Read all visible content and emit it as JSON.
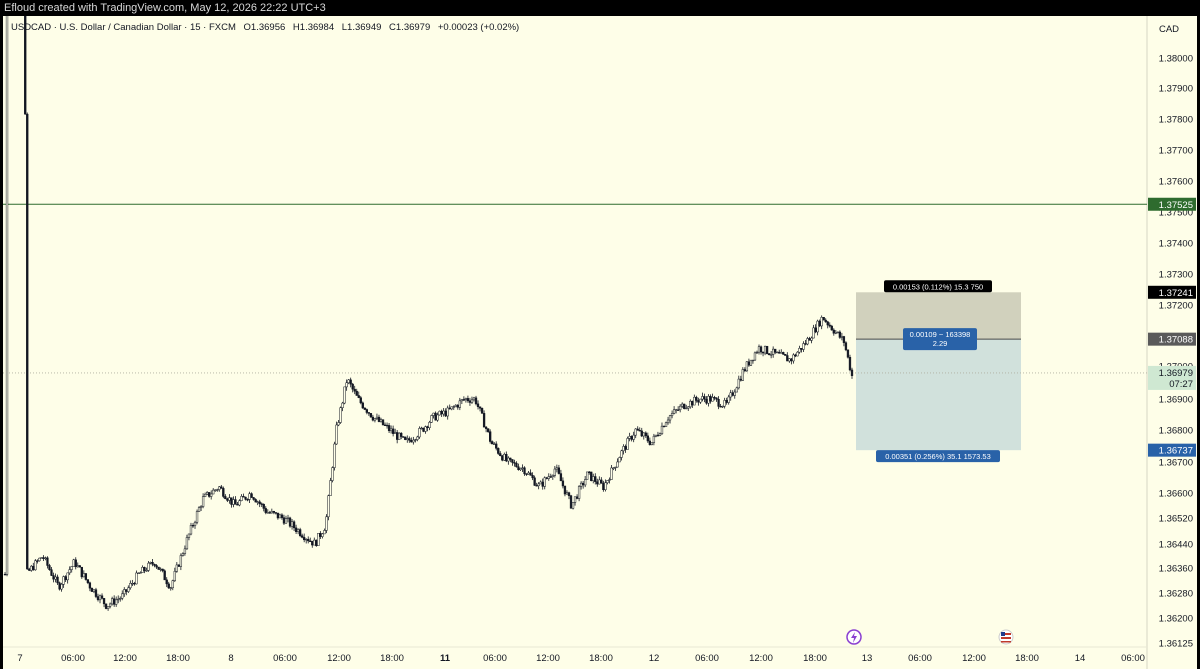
{
  "top_bar": {
    "text": "Efloud created with TradingView.com, May 12, 2026 22:22 UTC+3"
  },
  "legend": {
    "symbol": "USDCAD · U.S. Dollar / Canadian Dollar · 15 · FXCM",
    "open": "O1.36956",
    "high": "H1.36984",
    "low": "L1.36949",
    "close": "C1.36979",
    "change": "+0.00023 (+0.02%)"
  },
  "currency_label": "CAD",
  "colors": {
    "background": "#fefee8",
    "candle": "#131722",
    "horizontal_line": "#2e6b2e",
    "stop_zone": "#c9c9b5",
    "target_zone": "#cfdfdb",
    "position_label": "#2962a8"
  },
  "chart_data": {
    "type": "candlestick",
    "symbol": "USDCAD",
    "timeframe": "15",
    "y_axis": {
      "min": 1.36125,
      "max": 1.381,
      "ticks": [
        "1.38000",
        "1.37900",
        "1.37800",
        "1.37700",
        "1.37600",
        "1.37500",
        "1.37400",
        "1.37300",
        "1.37200",
        "1.37000",
        "1.36900",
        "1.36800",
        "1.36700",
        "1.36600",
        "1.36520",
        "1.36440",
        "1.36360",
        "1.36280",
        "1.36200",
        "1.36125"
      ]
    },
    "x_axis": {
      "ticks": [
        "7",
        "06:00",
        "12:00",
        "18:00",
        "8",
        "06:00",
        "12:00",
        "18:00",
        "11",
        "06:00",
        "12:00",
        "18:00",
        "12",
        "06:00",
        "12:00",
        "18:00",
        "13",
        "06:00",
        "12:00",
        "18:00",
        "14",
        "06:00"
      ],
      "bold_ticks": [
        "11"
      ]
    },
    "price_path": [
      {
        "t": 0,
        "p": 1.6343
      },
      {
        "t": 0.8,
        "p": 1.3634
      },
      {
        "t": 1.4,
        "p": 1.364
      },
      {
        "t": 2.0,
        "p": 1.363
      },
      {
        "t": 2.6,
        "p": 1.3638
      },
      {
        "t": 3.2,
        "p": 1.363
      },
      {
        "t": 3.8,
        "p": 1.3624
      },
      {
        "t": 4.4,
        "p": 1.3627
      },
      {
        "t": 5.0,
        "p": 1.3634
      },
      {
        "t": 5.6,
        "p": 1.3638
      },
      {
        "t": 6.2,
        "p": 1.363
      },
      {
        "t": 6.8,
        "p": 1.3645
      },
      {
        "t": 7.4,
        "p": 1.3658
      },
      {
        "t": 8.0,
        "p": 1.3662
      },
      {
        "t": 8.6,
        "p": 1.3656
      },
      {
        "t": 9.2,
        "p": 1.366
      },
      {
        "t": 9.8,
        "p": 1.3654
      },
      {
        "t": 10.4,
        "p": 1.3652
      },
      {
        "t": 11.0,
        "p": 1.3648
      },
      {
        "t": 11.6,
        "p": 1.3644
      },
      {
        "t": 12.0,
        "p": 1.365
      },
      {
        "t": 12.4,
        "p": 1.368
      },
      {
        "t": 12.8,
        "p": 1.3696
      },
      {
        "t": 13.2,
        "p": 1.369
      },
      {
        "t": 13.8,
        "p": 1.3684
      },
      {
        "t": 14.4,
        "p": 1.368
      },
      {
        "t": 15.0,
        "p": 1.3676
      },
      {
        "t": 15.6,
        "p": 1.368
      },
      {
        "t": 16.0,
        "p": 1.3684
      },
      {
        "t": 16.6,
        "p": 1.3686
      },
      {
        "t": 17.2,
        "p": 1.369
      },
      {
        "t": 17.6,
        "p": 1.369
      },
      {
        "t": 18.2,
        "p": 1.3676
      },
      {
        "t": 18.8,
        "p": 1.367
      },
      {
        "t": 19.4,
        "p": 1.3668
      },
      {
        "t": 20.0,
        "p": 1.3662
      },
      {
        "t": 20.6,
        "p": 1.3668
      },
      {
        "t": 21.2,
        "p": 1.3656
      },
      {
        "t": 21.8,
        "p": 1.3666
      },
      {
        "t": 22.4,
        "p": 1.3662
      },
      {
        "t": 23.0,
        "p": 1.3672
      },
      {
        "t": 23.6,
        "p": 1.368
      },
      {
        "t": 24.2,
        "p": 1.3676
      },
      {
        "t": 24.8,
        "p": 1.3684
      },
      {
        "t": 25.4,
        "p": 1.3688
      },
      {
        "t": 26.0,
        "p": 1.369
      },
      {
        "t": 26.4,
        "p": 1.369
      },
      {
        "t": 27.0,
        "p": 1.3688
      },
      {
        "t": 27.6,
        "p": 1.3698
      },
      {
        "t": 28.2,
        "p": 1.3706
      },
      {
        "t": 28.8,
        "p": 1.3704
      },
      {
        "t": 29.4,
        "p": 1.3702
      },
      {
        "t": 30.0,
        "p": 1.3708
      },
      {
        "t": 30.6,
        "p": 1.3716
      },
      {
        "t": 31.0,
        "p": 1.3712
      },
      {
        "t": 31.4,
        "p": 1.3708
      },
      {
        "t": 31.7,
        "p": 1.3697
      }
    ],
    "horizontal_line": {
      "price": 1.37525,
      "label": "1.37525"
    },
    "price_labels": [
      {
        "price": 1.37241,
        "label": "1.37241"
      },
      {
        "price": 1.37088,
        "label": "1.37088"
      },
      {
        "price": 1.36737,
        "label": "1.36737"
      }
    ],
    "current_price": {
      "price": 1.36979,
      "label": "1.36979",
      "countdown": "07:27"
    },
    "long_position": {
      "entry": 1.37088,
      "stop": 1.37241,
      "target": 1.36737,
      "stop_label": "0.00153 (0.112%) 15.3 750",
      "entry_label_line1": "0.00109 ~ 163398",
      "entry_label_line2": "2.29",
      "target_label": "0.00351 (0.256%) 35.1 1573.53"
    }
  }
}
